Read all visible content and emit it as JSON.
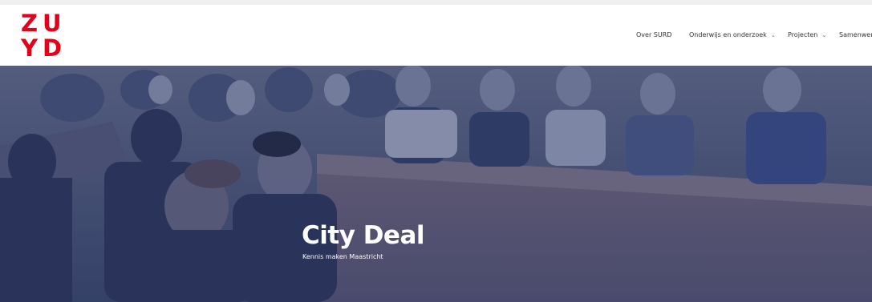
{
  "brand": {
    "logo_line1": "ZU",
    "logo_line2": "YD",
    "color": "#e2001a"
  },
  "nav": {
    "items": [
      {
        "label": "Over SURD",
        "has_dropdown": false
      },
      {
        "label": "Onderwijs en onderzoek",
        "has_dropdown": true
      },
      {
        "label": "Projecten",
        "has_dropdown": true
      },
      {
        "label": "Samenwer",
        "has_dropdown": false
      }
    ],
    "chevron": "⌄"
  },
  "hero": {
    "title": "City Deal",
    "subtitle": "Kennis maken Maastricht",
    "overlay_color": "#2a3a6a"
  }
}
